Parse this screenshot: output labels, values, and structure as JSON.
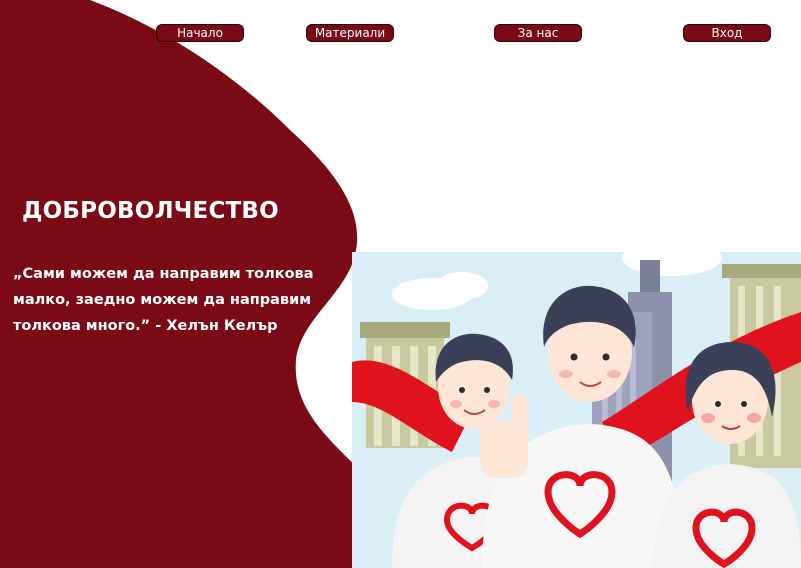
{
  "nav": {
    "home": "Начало",
    "materials": "Материали",
    "about": "За нас",
    "login": "Вход"
  },
  "hero": {
    "title": "ДОБРОВОЛЧЕСТВО",
    "quote": "„Сами можем да направим толкова малко, заедно можем да направим толкова много.” - Хелън Келър"
  },
  "illustration": {
    "subject": "three volunteers in white shirts with red heart logos, red ribbon, city buildings"
  },
  "colors": {
    "brand": "#7a0b16",
    "heart": "#e0121d",
    "sky": "#d9eef5"
  }
}
